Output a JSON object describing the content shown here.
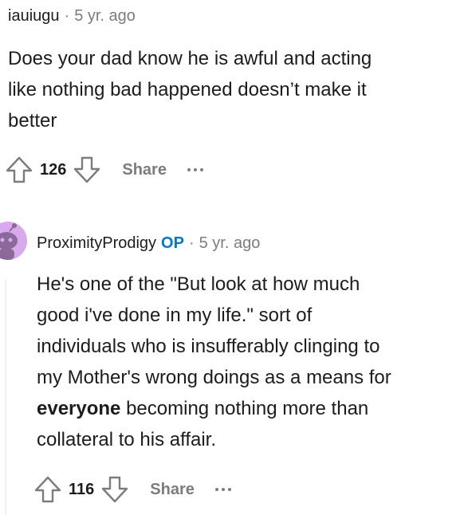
{
  "comments": [
    {
      "author": "iauiugu",
      "op_badge": "",
      "time": "5 yr. ago",
      "body_lines": [
        "Does your dad know he is awful and acting",
        "like nothing bad happened doesn’t make it",
        "better"
      ],
      "votes": "126",
      "share_label": "Share"
    },
    {
      "author": "ProximityProdigy",
      "op_badge": "OP",
      "time": "5 yr. ago",
      "body_lines": [
        "He's one of the \"But look at how much",
        "good i've done in my life.\" sort of",
        "individuals who is insufferably clinging to",
        "my Mother's wrong doings as a means for",
        "everyone",
        " becoming nothing more than",
        "collateral to his affair."
      ],
      "votes": "116",
      "share_label": "Share"
    }
  ],
  "separator": "·",
  "icons": {
    "upvote": "arrow-up-icon",
    "downvote": "arrow-down-icon",
    "more": "more-horizontal-icon",
    "avatar": "snoo-avatar-icon"
  },
  "colors": {
    "op_badge": "#0079d3",
    "muted": "#7c7c7c",
    "avatar_bg": "#d9a9ee",
    "thread_line": "#edeff1"
  }
}
